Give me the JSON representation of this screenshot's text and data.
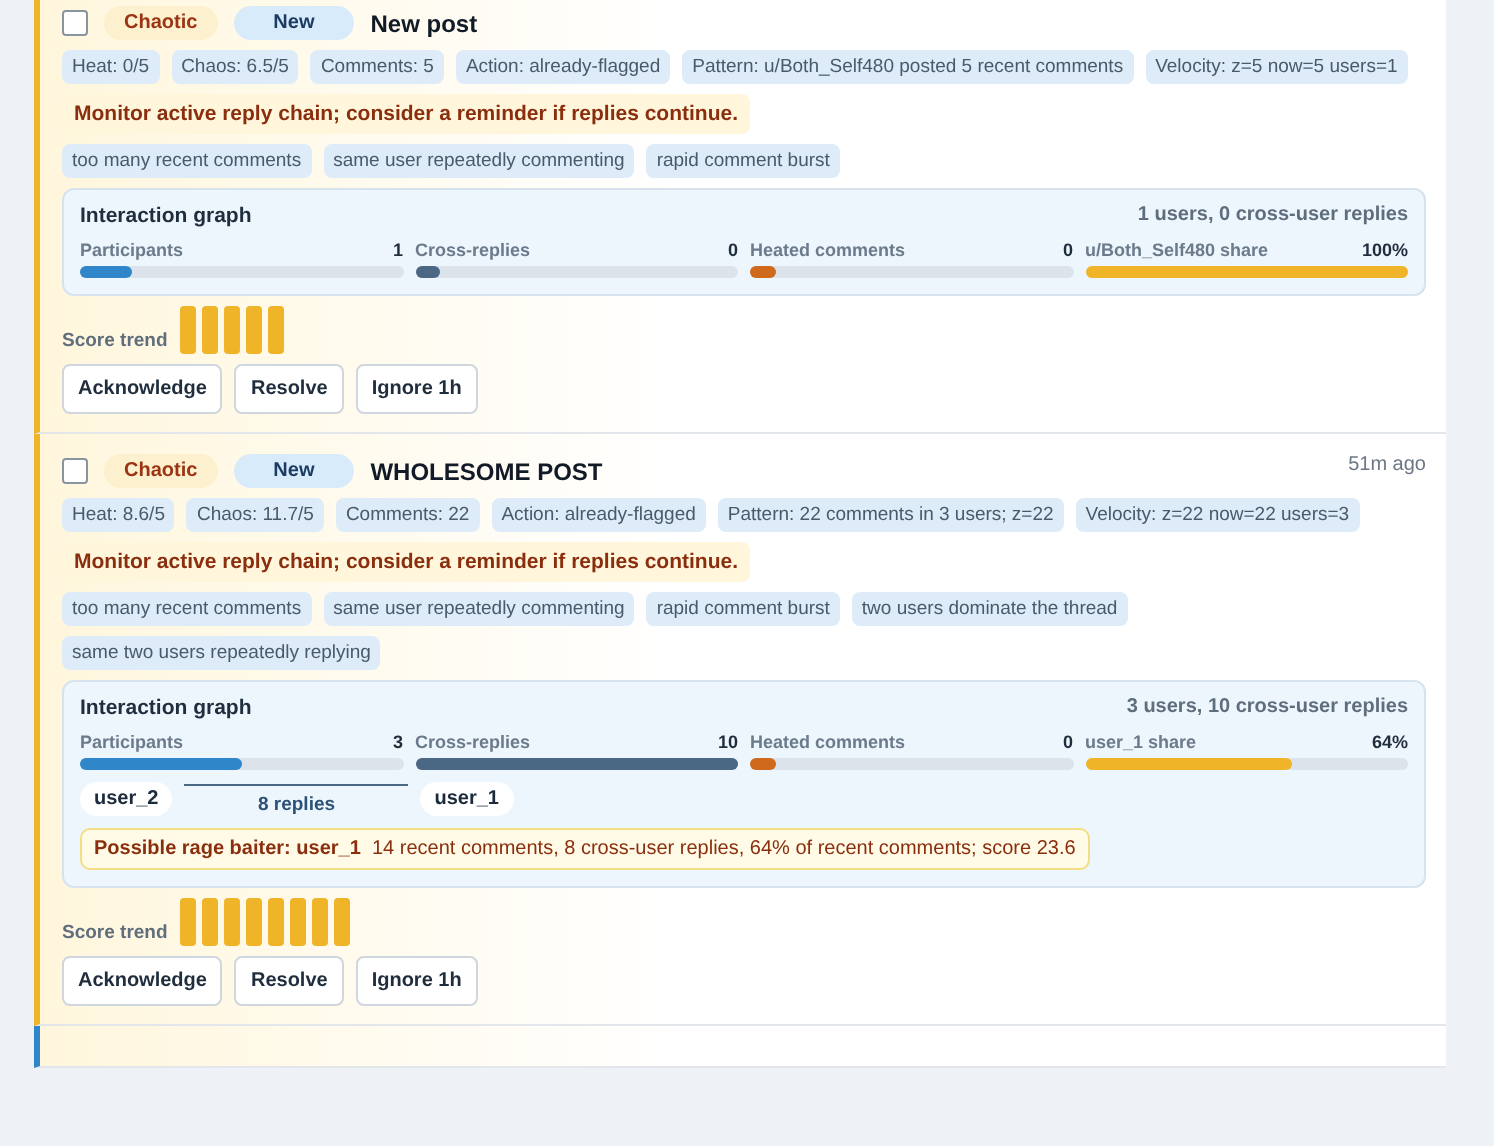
{
  "cards": [
    {
      "checked": false,
      "badges": [
        {
          "label": "Chaotic",
          "kind": "severity"
        },
        {
          "label": "New",
          "kind": "status"
        }
      ],
      "title": "New post",
      "stats": [
        "Heat: 0/5",
        "Chaos: 6.5/5",
        "Comments: 5",
        "Action: already-flagged",
        "Pattern: u/Both_Self480 posted 5 recent comments",
        "Velocity: z=5 now=5 users=1"
      ],
      "advice": "Monitor active reply chain; consider a reminder if replies continue.",
      "tags": [
        "too many recent comments",
        "same user repeatedly commenting",
        "rapid comment burst"
      ],
      "graph": {
        "title": "Interaction graph",
        "summary": "1 users, 0 cross-user replies",
        "meters": [
          {
            "label": "Participants",
            "value": "1",
            "kind": "participants",
            "level": 0.16
          },
          {
            "label": "Cross-replies",
            "value": "0",
            "kind": "cross",
            "level": 0.08
          },
          {
            "label": "Heated comments",
            "value": "0",
            "kind": "heated",
            "level": 0.08
          },
          {
            "label": "u/Both_Self480 share",
            "value": "100%",
            "kind": "share",
            "level": 1
          }
        ]
      },
      "trend": {
        "label": "Score trend",
        "bars": [
          {
            "kind": "score"
          },
          {
            "kind": "score"
          },
          {
            "kind": "score"
          },
          {
            "kind": "score"
          },
          {
            "kind": "score"
          }
        ]
      },
      "actions": [
        "Acknowledge",
        "Resolve",
        "Ignore 1h"
      ]
    },
    {
      "checked": false,
      "badges": [
        {
          "label": "Chaotic",
          "kind": "severity"
        },
        {
          "label": "New",
          "kind": "status"
        }
      ],
      "title": "WHOLESOME POST",
      "time": "51m ago",
      "stats": [
        "Heat: 8.6/5",
        "Chaos: 11.7/5",
        "Comments: 22",
        "Action: already-flagged",
        "Pattern: 22 comments in 3 users; z=22",
        "Velocity: z=22 now=22 users=3"
      ],
      "advice": "Monitor active reply chain; consider a reminder if replies continue.",
      "tags": [
        "too many recent comments",
        "same user repeatedly commenting",
        "rapid comment burst",
        "two users dominate the thread",
        "same two users repeatedly replying"
      ],
      "graph": {
        "title": "Interaction graph",
        "summary": "3 users, 10 cross-user replies",
        "meters": [
          {
            "label": "Participants",
            "value": "3",
            "kind": "participants",
            "level": 0.5
          },
          {
            "label": "Cross-replies",
            "value": "10",
            "kind": "cross",
            "level": 1
          },
          {
            "label": "Heated comments",
            "value": "0",
            "kind": "heated",
            "level": 0.08
          },
          {
            "label": "user_1 share",
            "value": "64%",
            "kind": "share",
            "level": 0.64
          }
        ],
        "pair": {
          "from": "user_2",
          "link": "8 replies",
          "to": "user_1"
        },
        "alert": {
          "label": "Possible rage baiter: user_1",
          "text": "14 recent comments, 8 cross-user replies, 64% of recent comments; score 23.6"
        }
      },
      "trend": {
        "label": "Score trend",
        "bars": [
          {
            "kind": "score"
          },
          {
            "kind": "score"
          },
          {
            "kind": "score"
          },
          {
            "kind": "score"
          },
          {
            "kind": "score"
          },
          {
            "kind": "score"
          },
          {
            "kind": "score"
          },
          {
            "kind": "score"
          }
        ]
      },
      "actions": [
        "Acknowledge",
        "Resolve",
        "Ignore 1h"
      ]
    }
  ]
}
